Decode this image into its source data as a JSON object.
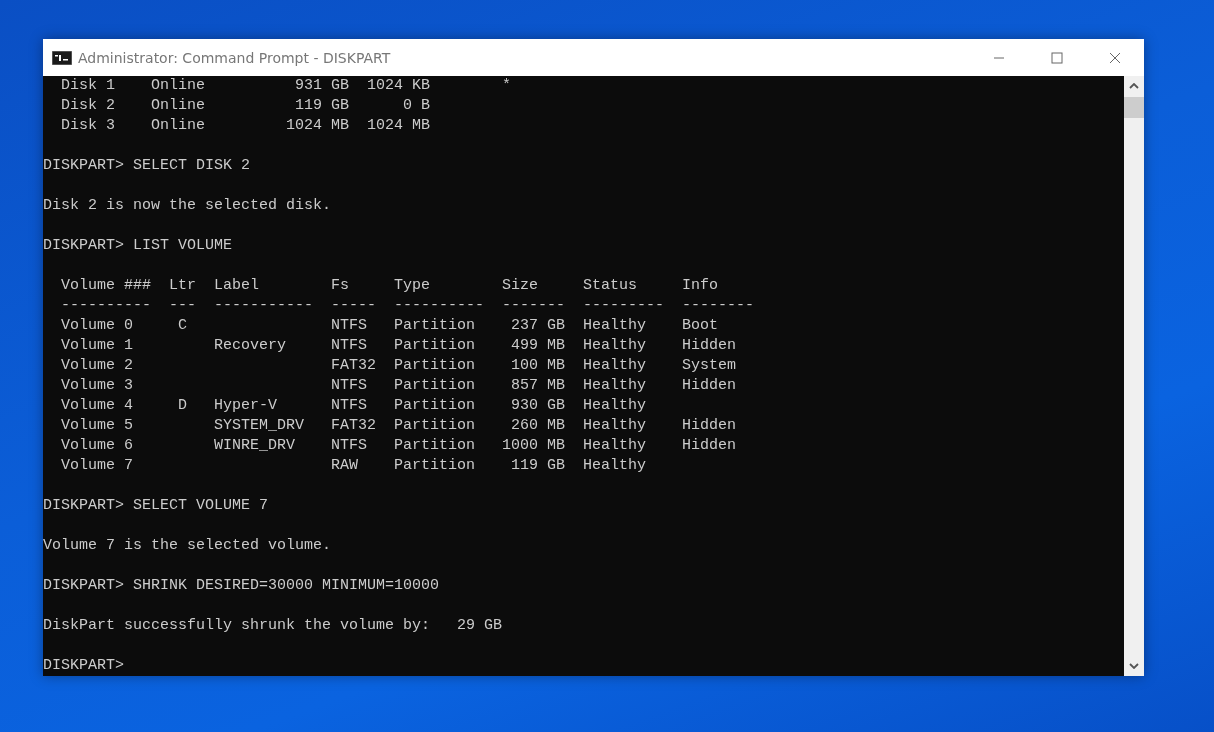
{
  "window": {
    "title": "Administrator: Command Prompt - DISKPART"
  },
  "console": {
    "blocks": [
      [
        "  Disk 1    Online          931 GB  1024 KB        *",
        "  Disk 2    Online          119 GB      0 B",
        "  Disk 3    Online         1024 MB  1024 MB"
      ],
      [
        "DISKPART> SELECT DISK 2"
      ],
      [
        "Disk 2 is now the selected disk."
      ],
      [
        "DISKPART> LIST VOLUME"
      ],
      [
        "  Volume ###  Ltr  Label        Fs     Type        Size     Status     Info",
        "  ----------  ---  -----------  -----  ----------  -------  ---------  --------",
        "  Volume 0     C                NTFS   Partition    237 GB  Healthy    Boot",
        "  Volume 1         Recovery     NTFS   Partition    499 MB  Healthy    Hidden",
        "  Volume 2                      FAT32  Partition    100 MB  Healthy    System",
        "  Volume 3                      NTFS   Partition    857 MB  Healthy    Hidden",
        "  Volume 4     D   Hyper-V      NTFS   Partition    930 GB  Healthy",
        "  Volume 5         SYSTEM_DRV   FAT32  Partition    260 MB  Healthy    Hidden",
        "  Volume 6         WINRE_DRV    NTFS   Partition   1000 MB  Healthy    Hidden",
        "  Volume 7                      RAW    Partition    119 GB  Healthy"
      ],
      [
        "DISKPART> SELECT VOLUME 7"
      ],
      [
        "Volume 7 is the selected volume."
      ],
      [
        "DISKPART> SHRINK DESIRED=30000 MINIMUM=10000"
      ],
      [
        "DiskPart successfully shrunk the volume by:   29 GB"
      ],
      [
        "DISKPART>"
      ]
    ]
  }
}
